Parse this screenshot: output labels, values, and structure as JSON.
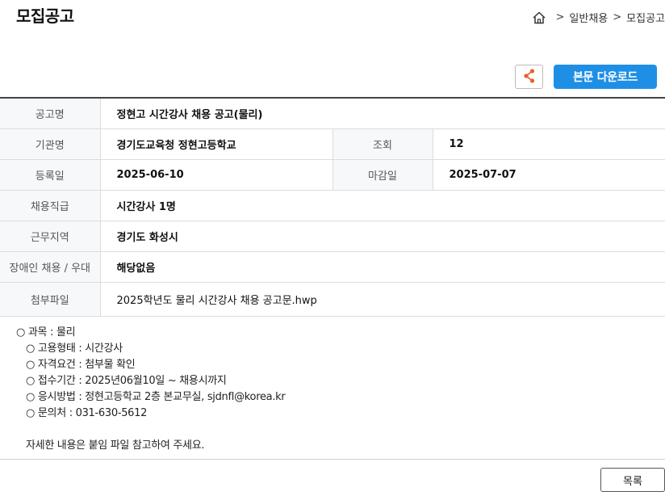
{
  "page_title": "모집공고",
  "breadcrumb": {
    "sep1": ">",
    "item1": "일반채용",
    "sep2": ">",
    "item2": "모집공고"
  },
  "toolbar": {
    "download_label": "본문 다운로드"
  },
  "info": {
    "title_label": "공고명",
    "title_value": "정현고 시간강사 채용 공고(물리)",
    "org_label": "기관명",
    "org_value": "경기도교육청 정현고등학교",
    "views_label": "조회",
    "views_value": "12",
    "reg_label": "등록일",
    "reg_value": "2025-06-10",
    "deadline_label": "마감일",
    "deadline_value": "2025-07-07",
    "position_label": "채용직급",
    "position_value": "시간강사 1명",
    "region_label": "근무지역",
    "region_value": "경기도 화성시",
    "disability_label": "장애인 채용 / 우대",
    "disability_value": "해당없음",
    "attach_label": "첨부파일",
    "attach_value": "2025학년도 물리 시간강사 채용 공고문.hwp"
  },
  "body": {
    "line1": "○ 과목 : 물리",
    "line2": "○ 고용형태 : 시간강사",
    "line3": "○ 자격요건 : 첨부물 확인",
    "line4": "○ 접수기간 : 2025년06월10일 ~ 채용시까지",
    "line5": "○ 응시방법 : 정현고등학교 2층 본교무실, sjdnfl@korea.kr",
    "line6": "○ 문의처 : 031-630-5612",
    "closing": "자세한 내용은 붙임 파일 참고하여 주세요."
  },
  "footer": {
    "list_label": "목록"
  },
  "colors": {
    "accent": "#1f8fe6",
    "share_icon": "#e8602c"
  }
}
